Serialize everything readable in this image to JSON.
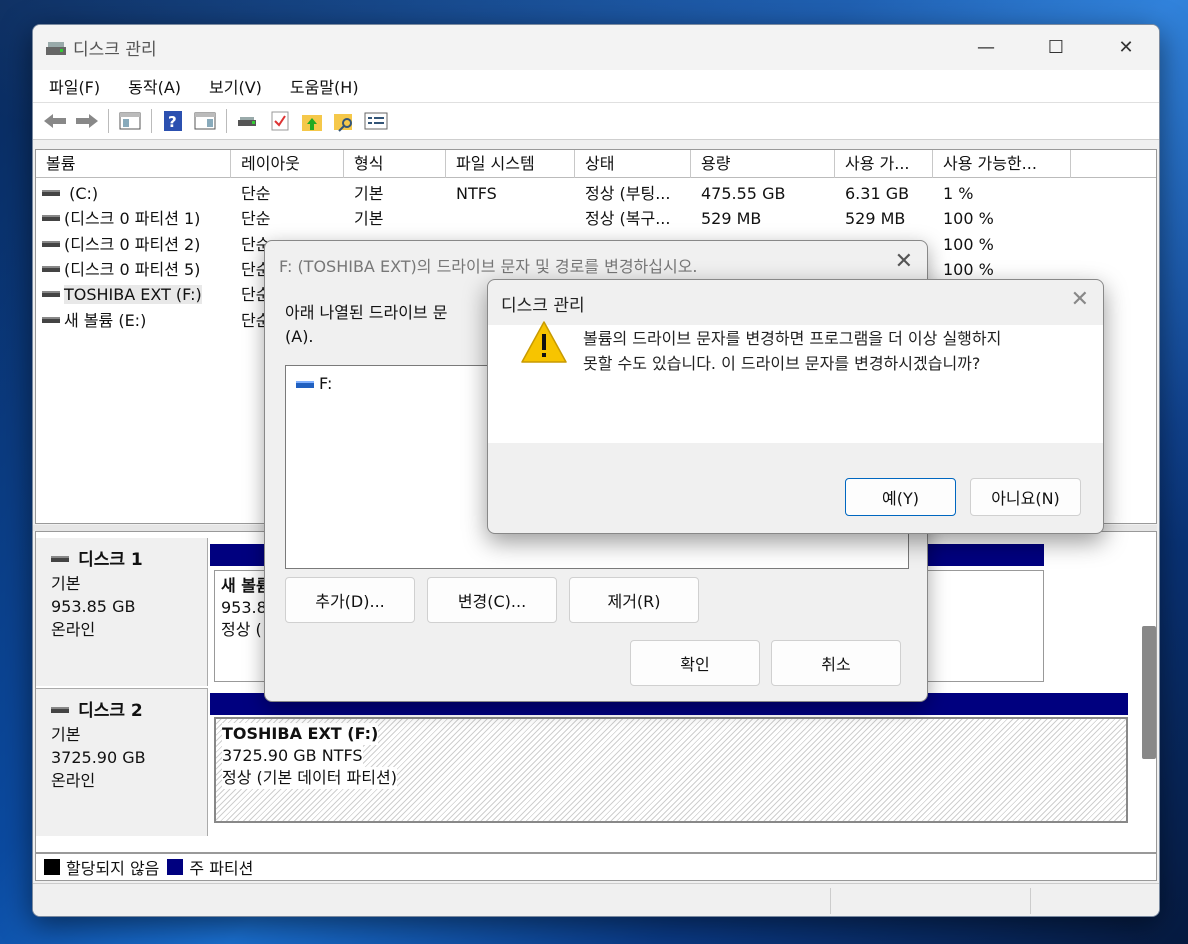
{
  "window": {
    "title": "디스크 관리",
    "minimize": "—",
    "maximize": "☐",
    "close": "✕"
  },
  "menu": [
    "파일(F)",
    "동작(A)",
    "보기(V)",
    "도움말(H)"
  ],
  "toolbar": {
    "icons": [
      "back-arrow-icon",
      "forward-arrow-icon",
      "console-tree-icon",
      "help-icon",
      "show-pane-icon",
      "connect-drive-icon",
      "checklist-icon",
      "up-folder-icon",
      "search-folder-icon",
      "properties-icon"
    ]
  },
  "volume_list": {
    "headers": [
      "볼륨",
      "레이아웃",
      "형식",
      "파일 시스템",
      "상태",
      "용량",
      "사용 가...",
      "사용 가능한..."
    ],
    "rows": [
      {
        "name": " (C:)",
        "layout": "단순",
        "type": "기본",
        "fs": "NTFS",
        "status": "정상 (부팅...",
        "capacity": "475.55 GB",
        "free": "6.31 GB",
        "pct": "1 %"
      },
      {
        "name": "(디스크 0 파티션 1)",
        "layout": "단순",
        "type": "기본",
        "fs": "",
        "status": "정상 (복구...",
        "capacity": "529 MB",
        "free": "529 MB",
        "pct": "100 %"
      },
      {
        "name": "(디스크 0 파티션 2)",
        "layout": "단순",
        "type": "",
        "fs": "",
        "status": "",
        "capacity": "",
        "free": "",
        "pct": "100 %"
      },
      {
        "name": "(디스크 0 파티션 5)",
        "layout": "단순",
        "type": "",
        "fs": "",
        "status": "",
        "capacity": "",
        "free": "",
        "pct": "100 %"
      },
      {
        "name": "TOSHIBA EXT (F:)",
        "layout": "단순",
        "type": "",
        "fs": "",
        "status": "",
        "capacity": "",
        "free": "",
        "pct": ""
      },
      {
        "name": "새 볼륨 (E:)",
        "layout": "단순",
        "type": "",
        "fs": "",
        "status": "",
        "capacity": "",
        "free": "",
        "pct": ""
      }
    ]
  },
  "disks": [
    {
      "name": "디스크 1",
      "type": "기본",
      "size": "953.85 GB",
      "state": "온라인",
      "volume": {
        "name": "새 볼륨",
        "size": "953.85",
        "status": "정상 ("
      }
    },
    {
      "name": "디스크 2",
      "type": "기본",
      "size": "3725.90 GB",
      "state": "온라인",
      "volume": {
        "name": "TOSHIBA EXT  (F:)",
        "size": "3725.90 GB NTFS",
        "status": "정상 (기본 데이터 파티션)"
      }
    }
  ],
  "legend": {
    "unallocated": "할당되지 않음",
    "primary": "주 파티션",
    "unallocated_color": "#000000",
    "primary_color": "#00007f"
  },
  "change_dialog": {
    "title": "F: (TOSHIBA EXT)의 드라이브 문자 및 경로를 변경하십시오.",
    "message_line1": "아래 나열된 드라이브 문",
    "message_line2": "(A).",
    "list_item": "F:",
    "add": "추가(D)...",
    "change": "변경(C)...",
    "remove": "제거(R)",
    "ok": "확인",
    "cancel": "취소"
  },
  "confirm_dialog": {
    "title": "디스크 관리",
    "line1": "볼륨의 드라이브 문자를 변경하면 프로그램을 더 이상 실행하지",
    "line2": "못할 수도 있습니다. 이 드라이브 문자를 변경하시겠습니까?",
    "yes": "예(Y)",
    "no": "아니요(N)",
    "yes_border_color": "#0067c0"
  }
}
